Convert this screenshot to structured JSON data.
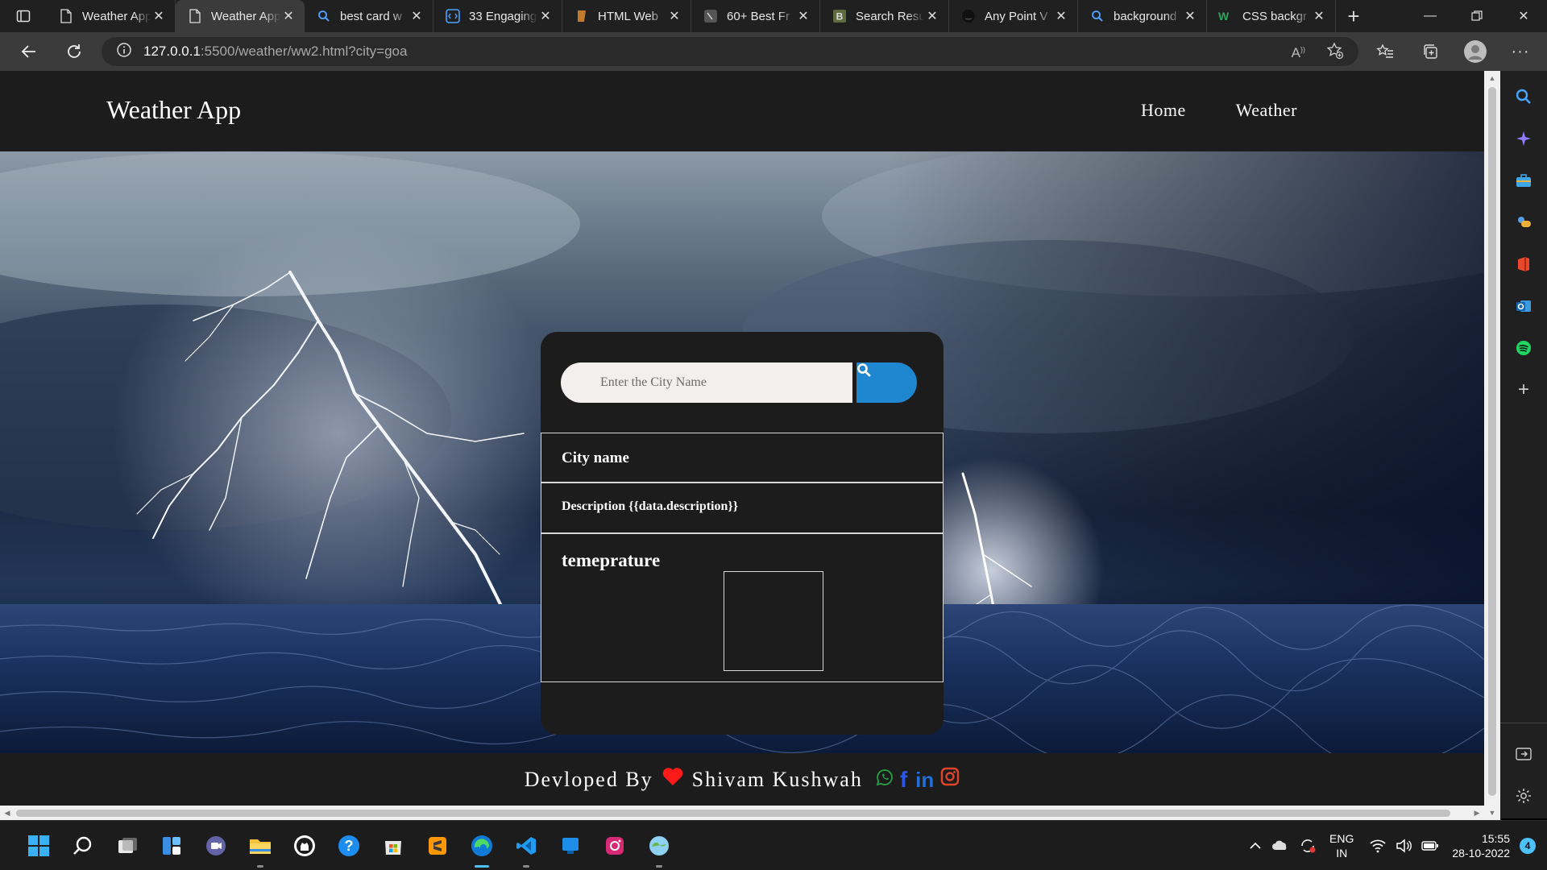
{
  "browser": {
    "tabs": [
      {
        "title": "Weather App",
        "icon": "page-icon",
        "active": false
      },
      {
        "title": "Weather App",
        "icon": "page-icon",
        "active": true
      },
      {
        "title": "best card w",
        "icon": "search-icon",
        "active": false
      },
      {
        "title": "33 Engaging",
        "icon": "code-icon",
        "active": false
      },
      {
        "title": "HTML Web",
        "icon": "book-icon",
        "active": false
      },
      {
        "title": "60+ Best Fr",
        "icon": "site-icon",
        "active": false
      },
      {
        "title": "Search Resu",
        "icon": "b-icon",
        "active": false
      },
      {
        "title": "Any Point V",
        "icon": "github-icon",
        "active": false
      },
      {
        "title": "background",
        "icon": "search-icon",
        "active": false
      },
      {
        "title": "CSS backgr",
        "icon": "w3-icon",
        "active": false
      }
    ],
    "url_host": "127.0.0.1",
    "url_rest": ":5500/weather/ww2.html?city=goa",
    "read_aloud_label": "A"
  },
  "page": {
    "brand": "Weather App",
    "nav": [
      {
        "label": "Home"
      },
      {
        "label": "Weather"
      }
    ],
    "search": {
      "placeholder": "Enter the City Name"
    },
    "card": {
      "city_label": "City name",
      "description_label": "Description {{data.description}}",
      "temperature_label": "temeprature"
    },
    "footer": {
      "prefix": "Devloped By",
      "author": "Shivam Kushwah"
    }
  },
  "taskbar": {
    "lang_line1": "ENG",
    "lang_line2": "IN",
    "time": "15:55",
    "date": "28-10-2022",
    "notification_count": "4"
  },
  "colors": {
    "accent": "#1f86d0",
    "heart": "#ff1a1a",
    "whatsapp": "#25a244",
    "facebook": "#2c56e8",
    "linkedin": "#1f6fd6",
    "instagram": "#e0452a"
  }
}
